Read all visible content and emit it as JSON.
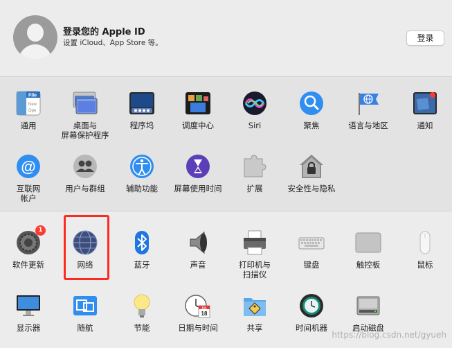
{
  "account": {
    "title": "登录您的 Apple ID",
    "subtitle": "设置 iCloud、App Store 等。",
    "login_button": "登录"
  },
  "row1": [
    {
      "label": "通用",
      "icon": "general-icon"
    },
    {
      "label": "桌面与\n屏幕保护程序",
      "icon": "desktop-icon"
    },
    {
      "label": "程序坞",
      "icon": "dock-icon"
    },
    {
      "label": "调度中心",
      "icon": "mission-control-icon"
    },
    {
      "label": "Siri",
      "icon": "siri-icon"
    },
    {
      "label": "聚焦",
      "icon": "spotlight-icon"
    },
    {
      "label": "语言与地区",
      "icon": "language-icon"
    },
    {
      "label": "通知",
      "icon": "notifications-icon"
    }
  ],
  "row2": [
    {
      "label": "互联网\n帐户",
      "icon": "internet-accounts-icon"
    },
    {
      "label": "用户与群组",
      "icon": "users-icon"
    },
    {
      "label": "辅助功能",
      "icon": "accessibility-icon"
    },
    {
      "label": "屏幕使用时间",
      "icon": "screen-time-icon"
    },
    {
      "label": "扩展",
      "icon": "extensions-icon"
    },
    {
      "label": "安全性与隐私",
      "icon": "security-icon"
    }
  ],
  "row3": [
    {
      "label": "软件更新",
      "icon": "software-update-icon",
      "badge": "1"
    },
    {
      "label": "网络",
      "icon": "network-icon"
    },
    {
      "label": "蓝牙",
      "icon": "bluetooth-icon"
    },
    {
      "label": "声音",
      "icon": "sound-icon"
    },
    {
      "label": "打印机与\n扫描仪",
      "icon": "printer-icon"
    },
    {
      "label": "键盘",
      "icon": "keyboard-icon"
    },
    {
      "label": "触控板",
      "icon": "trackpad-icon"
    },
    {
      "label": "鼠标",
      "icon": "mouse-icon"
    }
  ],
  "row4": [
    {
      "label": "显示器",
      "icon": "displays-icon"
    },
    {
      "label": "随航",
      "icon": "sidecar-icon"
    },
    {
      "label": "节能",
      "icon": "energy-saver-icon"
    },
    {
      "label": "日期与时间",
      "icon": "date-time-icon"
    },
    {
      "label": "共享",
      "icon": "sharing-icon"
    },
    {
      "label": "时间机器",
      "icon": "time-machine-icon"
    },
    {
      "label": "启动磁盘",
      "icon": "startup-disk-icon"
    }
  ],
  "date_icon": {
    "month": "JUL",
    "day": "18"
  },
  "watermark": "https://blog.csdn.net/gyueh",
  "highlight_color": "#ff2a1f"
}
